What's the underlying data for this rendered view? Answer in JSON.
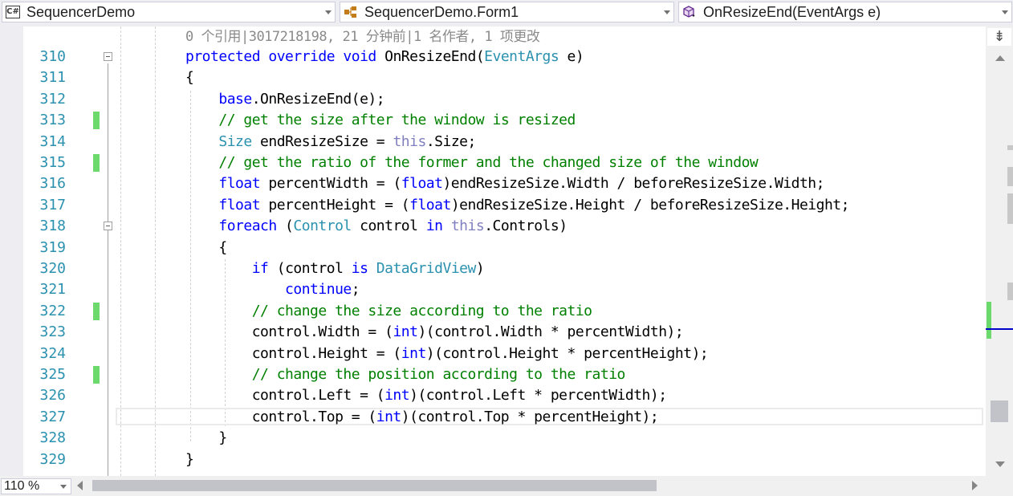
{
  "navbar": {
    "project": {
      "label": "SequencerDemo",
      "icon": "csharp-project-icon",
      "icon_text": "C#"
    },
    "class": {
      "label": "SequencerDemo.Form1",
      "icon": "class-icon"
    },
    "member": {
      "label": "OnResizeEnd(EventArgs e)",
      "icon": "method-icon"
    }
  },
  "editor": {
    "codelens": "0 个引用|3017218198, 21 分钟前|1 名作者, 1 项更改",
    "lines": [
      {
        "n": "310",
        "segs": [
          [
            "kw",
            "protected "
          ],
          [
            "kw",
            "override "
          ],
          [
            "kw",
            "void "
          ],
          [
            "",
            "OnResizeEnd("
          ],
          [
            "ty",
            "EventArgs"
          ],
          [
            "",
            " e)"
          ]
        ]
      },
      {
        "n": "311",
        "segs": [
          [
            "",
            "{"
          ]
        ]
      },
      {
        "n": "312",
        "segs": [
          [
            "",
            "    "
          ],
          [
            "kw",
            "base"
          ],
          [
            "",
            ".OnResizeEnd(e);"
          ]
        ]
      },
      {
        "n": "313",
        "segs": [
          [
            "",
            "    "
          ],
          [
            "cm",
            "// get the size after the window is resized"
          ]
        ]
      },
      {
        "n": "314",
        "segs": [
          [
            "",
            "    "
          ],
          [
            "ty",
            "Size"
          ],
          [
            "",
            " endResizeSize = "
          ],
          [
            "th",
            "this"
          ],
          [
            "",
            ".Size;"
          ]
        ]
      },
      {
        "n": "315",
        "segs": [
          [
            "",
            "    "
          ],
          [
            "cm",
            "// get the ratio of the former and the changed size of the window"
          ]
        ]
      },
      {
        "n": "316",
        "segs": [
          [
            "",
            "    "
          ],
          [
            "kw",
            "float"
          ],
          [
            "",
            " percentWidth = ("
          ],
          [
            "kw",
            "float"
          ],
          [
            "",
            ")endResizeSize.Width / beforeResizeSize.Width;"
          ]
        ]
      },
      {
        "n": "317",
        "segs": [
          [
            "",
            "    "
          ],
          [
            "kw",
            "float"
          ],
          [
            "",
            " percentHeight = ("
          ],
          [
            "kw",
            "float"
          ],
          [
            "",
            ")endResizeSize.Height / beforeResizeSize.Height;"
          ]
        ]
      },
      {
        "n": "318",
        "segs": [
          [
            "",
            "    "
          ],
          [
            "kw",
            "foreach"
          ],
          [
            "",
            " ("
          ],
          [
            "ty",
            "Control"
          ],
          [
            "",
            " control "
          ],
          [
            "kw",
            "in "
          ],
          [
            "th",
            "this"
          ],
          [
            "",
            ".Controls)"
          ]
        ]
      },
      {
        "n": "319",
        "segs": [
          [
            "",
            "    {"
          ]
        ]
      },
      {
        "n": "320",
        "segs": [
          [
            "",
            "        "
          ],
          [
            "kw",
            "if"
          ],
          [
            "",
            " (control "
          ],
          [
            "kw",
            "is "
          ],
          [
            "ty",
            "DataGridView"
          ],
          [
            "",
            ")"
          ]
        ]
      },
      {
        "n": "321",
        "segs": [
          [
            "",
            "            "
          ],
          [
            "kw",
            "continue"
          ],
          [
            "",
            ";"
          ]
        ]
      },
      {
        "n": "322",
        "segs": [
          [
            "",
            "        "
          ],
          [
            "cm",
            "// change the size according to the ratio"
          ]
        ]
      },
      {
        "n": "323",
        "segs": [
          [
            "",
            "        control.Width = ("
          ],
          [
            "kw",
            "int"
          ],
          [
            "",
            ")(control.Width * percentWidth);"
          ]
        ]
      },
      {
        "n": "324",
        "segs": [
          [
            "",
            "        control.Height = ("
          ],
          [
            "kw",
            "int"
          ],
          [
            "",
            ")(control.Height * percentHeight);"
          ]
        ]
      },
      {
        "n": "325",
        "segs": [
          [
            "",
            "        "
          ],
          [
            "cm",
            "// change the position according to the ratio"
          ]
        ]
      },
      {
        "n": "326",
        "segs": [
          [
            "",
            "        control.Left = ("
          ],
          [
            "kw",
            "int"
          ],
          [
            "",
            ")(control.Left * percentWidth);"
          ]
        ]
      },
      {
        "n": "327",
        "segs": [
          [
            "",
            "        control.Top = ("
          ],
          [
            "kw",
            "int"
          ],
          [
            "",
            ")(control.Top * percentHeight);"
          ]
        ]
      },
      {
        "n": "328",
        "segs": [
          [
            "",
            "    }"
          ]
        ]
      },
      {
        "n": "329",
        "segs": [
          [
            "",
            "}"
          ]
        ]
      }
    ],
    "changed_lines": [
      "313",
      "315",
      "322",
      "325"
    ],
    "folded_lines": [
      "310",
      "318"
    ],
    "current_line": "327"
  },
  "statusbar": {
    "zoom": "110 %"
  },
  "colors": {
    "keyword": "#0000ff",
    "type": "#2b91af",
    "comment": "#008000",
    "this": "#8080c0",
    "line_number": "#2b91af",
    "change_marker": "#6bd96b"
  }
}
